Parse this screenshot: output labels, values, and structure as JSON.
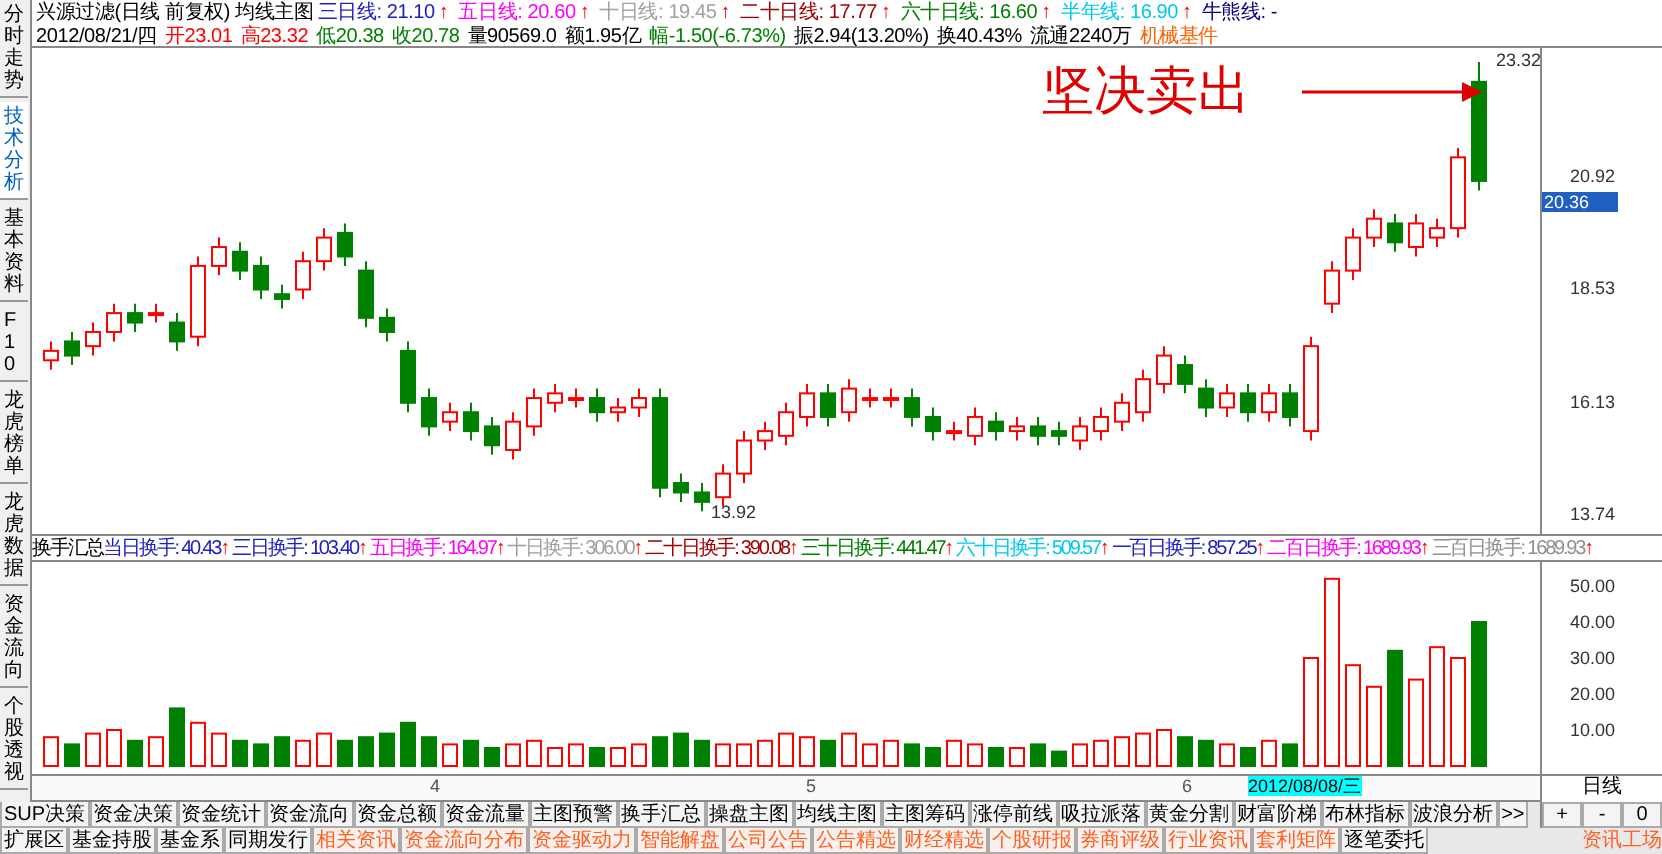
{
  "header": {
    "title": "兴源过滤(日线 前复权) 均线主图",
    "averages": [
      {
        "label": "三日线: 21.10",
        "arrow": "↑",
        "color": "#2020c0"
      },
      {
        "label": "五日线: 20.60",
        "arrow": "↑",
        "color": "#ff00ff"
      },
      {
        "label": "十日线: 19.45",
        "arrow": "↑",
        "color": "#a0a0a0"
      },
      {
        "label": "二十日线: 17.77",
        "arrow": "↑",
        "color": "#a00000"
      },
      {
        "label": "六十日线: 16.60",
        "arrow": "↑",
        "color": "#008000"
      },
      {
        "label": "半年线: 16.90",
        "arrow": "↑",
        "color": "#00c8f0"
      }
    ],
    "trend": {
      "label": "牛熊线: -",
      "color": "#000080"
    },
    "quote": [
      {
        "text": "2012/08/21/四",
        "color": "#000000"
      },
      {
        "text": "开23.01",
        "color": "#ff0000"
      },
      {
        "text": "高23.32",
        "color": "#ff0000"
      },
      {
        "text": "低20.38",
        "color": "#008000"
      },
      {
        "text": "收20.78",
        "color": "#008000"
      },
      {
        "text": "量90569.0",
        "color": "#000000"
      },
      {
        "text": "额1.95亿",
        "color": "#000000"
      },
      {
        "text": "幅-1.50(-6.73%)",
        "color": "#008000"
      },
      {
        "text": "振2.94(13.20%)",
        "color": "#000000"
      },
      {
        "text": "换40.43%",
        "color": "#000000"
      },
      {
        "text": "流通2240万",
        "color": "#000000"
      },
      {
        "text": "机械基件",
        "color": "#ff6000"
      }
    ]
  },
  "sidebar": {
    "items": [
      {
        "label": "分时走势",
        "selected": false
      },
      {
        "label": "技术分析",
        "selected": true
      },
      {
        "label": "基本资料",
        "selected": false
      },
      {
        "label": "F10",
        "selected": false
      },
      {
        "label": "龙虎榜单",
        "selected": false
      },
      {
        "label": "龙虎数据",
        "selected": false
      },
      {
        "label": "资金流向",
        "selected": false
      },
      {
        "label": "个股透视",
        "selected": false
      }
    ]
  },
  "price_chart": {
    "annotation": "坚决卖出",
    "high_mark": "23.32",
    "low_mark": "13.92",
    "axis": [
      "20.92",
      "18.53",
      "16.13",
      "13.74"
    ],
    "current_price": "20.36"
  },
  "turnover": {
    "title": "换手汇总",
    "items": [
      {
        "label": "当日换手: 40.43",
        "arrow": "↑",
        "color": "#2020c0"
      },
      {
        "label": "三日换手: 103.40",
        "arrow": "↑",
        "color": "#2020c0"
      },
      {
        "label": "五日换手: 164.97",
        "arrow": "↑",
        "color": "#ff00ff"
      },
      {
        "label": "十日换手: 306.00",
        "arrow": "↑",
        "color": "#a0a0a0"
      },
      {
        "label": "二十日换手: 390.08",
        "arrow": "↑",
        "color": "#a00000"
      },
      {
        "label": "三十日换手: 441.47",
        "arrow": "↑",
        "color": "#008000"
      },
      {
        "label": "六十日换手: 509.57",
        "arrow": "↑",
        "color": "#00c8f0"
      },
      {
        "label": "一百日换手: 857.25",
        "arrow": "↑",
        "color": "#2020c0"
      },
      {
        "label": "二百日换手: 1689.93",
        "arrow": "↑",
        "color": "#ff00ff"
      },
      {
        "label": "三百日换手: 1689.93",
        "arrow": "↑",
        "color": "#909090"
      }
    ],
    "axis": [
      "50.00",
      "40.00",
      "30.00",
      "20.00",
      "10.00"
    ]
  },
  "time_axis": {
    "labels": [
      "4",
      "5",
      "6"
    ],
    "cursor_date": "2012/08/08/三",
    "period": "日线"
  },
  "indicator_tabs": [
    "SUP决策",
    "资金决策",
    "资金统计",
    "资金流向",
    "资金总额",
    "资金流量",
    "主图预警",
    "换手汇总",
    "操盘主图",
    "均线主图",
    "主图筹码",
    "涨停前线",
    "吸拉派落",
    "黄金分割",
    "财富阶梯",
    "布林指标",
    "波浪分析",
    ">>"
  ],
  "zoom_buttons": [
    "+",
    "-",
    "0"
  ],
  "info_tabs": [
    {
      "label": "扩展区",
      "kind": "plain"
    },
    {
      "label": "基金持股",
      "kind": "plain"
    },
    {
      "label": "基金系",
      "kind": "plain"
    },
    {
      "label": "同期发行",
      "kind": "plain"
    },
    {
      "label": "相关资讯",
      "kind": "news"
    },
    {
      "label": "资金流向分布",
      "kind": "news"
    },
    {
      "label": "资金驱动力",
      "kind": "news"
    },
    {
      "label": "智能解盘",
      "kind": "news"
    },
    {
      "label": "公司公告",
      "kind": "news"
    },
    {
      "label": "公告精选",
      "kind": "news"
    },
    {
      "label": "财经精选",
      "kind": "news"
    },
    {
      "label": "个股研报",
      "kind": "news"
    },
    {
      "label": "券商评级",
      "kind": "news"
    },
    {
      "label": "行业资讯",
      "kind": "news"
    },
    {
      "label": "套利矩阵",
      "kind": "news"
    },
    {
      "label": "逐笔委托",
      "kind": "plain"
    }
  ],
  "info_corner": "资讯工场"
}
